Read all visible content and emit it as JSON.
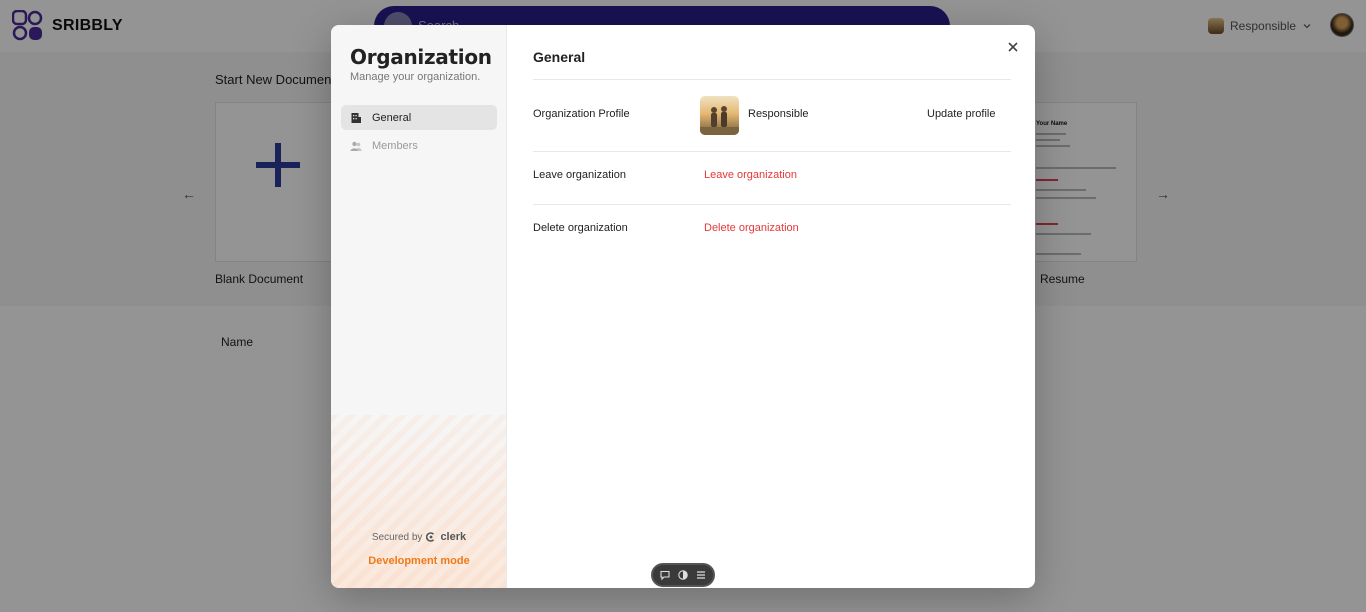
{
  "app": {
    "brand": "SRIBBLY"
  },
  "header": {
    "search_placeholder": "Search",
    "org_name": "Responsible"
  },
  "home": {
    "start_title": "Start New Document",
    "templates": [
      {
        "label": "Blank Document"
      },
      {
        "label": "Resume",
        "preview_heading": "Your Name"
      }
    ],
    "table_header_name": "Name"
  },
  "modal": {
    "sidebar": {
      "title": "Organization",
      "subtitle": "Manage your organization.",
      "items": [
        {
          "label": "General",
          "active": true
        },
        {
          "label": "Members",
          "active": false
        }
      ],
      "secured_by": "Secured by",
      "provider": "clerk",
      "dev_mode": "Development mode"
    },
    "main": {
      "title": "General",
      "rows": [
        {
          "label": "Organization Profile",
          "value": "Responsible",
          "action": "Update profile"
        },
        {
          "label": "Leave organization",
          "action": "Leave organization"
        },
        {
          "label": "Delete organization",
          "action": "Delete organization"
        }
      ]
    }
  },
  "colors": {
    "accent_danger": "#e5383b",
    "dev_mode": "#f07a1a",
    "search_bg": "#2a1f8f",
    "brand_logo": "#4a2a9a"
  }
}
